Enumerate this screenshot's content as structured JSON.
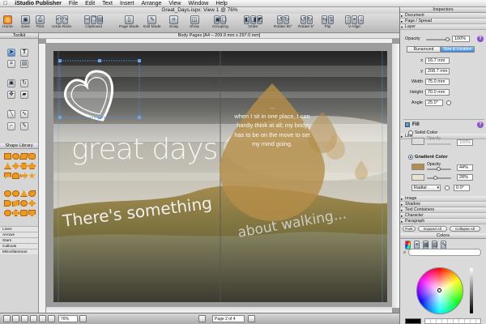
{
  "menubar": {
    "apple": "",
    "app_name": "iStudio Publisher",
    "items": [
      "File",
      "Edit",
      "Text",
      "Insert",
      "Arrange",
      "View",
      "Window",
      "Help"
    ]
  },
  "window": {
    "title": "Great_Days.ispx: View 1 @ 76%"
  },
  "toolbar": {
    "home": "Home",
    "save": "Save",
    "print": "Print",
    "undo_redo": "Undo Redo",
    "clipboard": "Clipboard",
    "page_mode": "Page Mode",
    "edit_mode": "Edit Mode",
    "snap": "Snap",
    "show": "Show",
    "grouping": "Grouping",
    "order": "Order",
    "rotate90": "Rotate 90°",
    "rotate5": "Rotate 5°",
    "flip": "Flip",
    "valign": "V-Align"
  },
  "toolkit": {
    "title": "Toolkit",
    "shape_library_title": "Shape Library",
    "library_items": [
      "Lines",
      "Arrows",
      "Stars",
      "Callouts",
      "Miscellaneous"
    ]
  },
  "document": {
    "header": "Body Pages [A4 – 209.9 mm x 297.0 mm]",
    "headline": "great days",
    "tagline_1": "There's something",
    "tagline_2": "about walking...",
    "quote_ellipsis": "...",
    "quote": "when I sit in one place, I can hardly think at all; my body has to be on the move to set my mind going."
  },
  "statusbar": {
    "zoom": "76%",
    "page": "Page 2 of 4"
  },
  "inspector": {
    "title": "Inspectors",
    "sections_top": [
      "Document",
      "Page / Spread",
      "Layer"
    ],
    "opacity_label": "Opacity",
    "opacity_value": "100%",
    "tab_runaround": "Runaround",
    "tab_size": "Size & Location",
    "x_label": "x",
    "x_value": "16.7 mm",
    "y_label": "y",
    "y_value": "208.7 mm",
    "width_label": "Width",
    "width_value": "75.0 mm",
    "height_label": "Height",
    "height_value": "70.0 mm",
    "angle_label": "Angle",
    "angle_value": "25.0°",
    "line_section": "Line",
    "fill_label": "Fill",
    "solid_color": "Solid Color",
    "solid_opacity_label": "Opacity",
    "solid_opacity_value": "100%",
    "gradient_color": "Gradient Color",
    "grad_opacity_label": "Opacity",
    "grad_opacity_1": "44%",
    "grad_opacity_2": "28%",
    "grad_type": "Radial",
    "grad_angle": "0.0°",
    "sections_bottom": [
      "Image",
      "Shadow",
      "Text Containers",
      "Character",
      "Paragraph"
    ],
    "park": "Park",
    "expand_all": "Expand All",
    "collapse_all": "Collapse All",
    "colors_title": "Colors"
  },
  "colors": {
    "accent": "#3a86d8",
    "shape_orange": "#f09a1c",
    "callout_tan": "#b48d48"
  }
}
